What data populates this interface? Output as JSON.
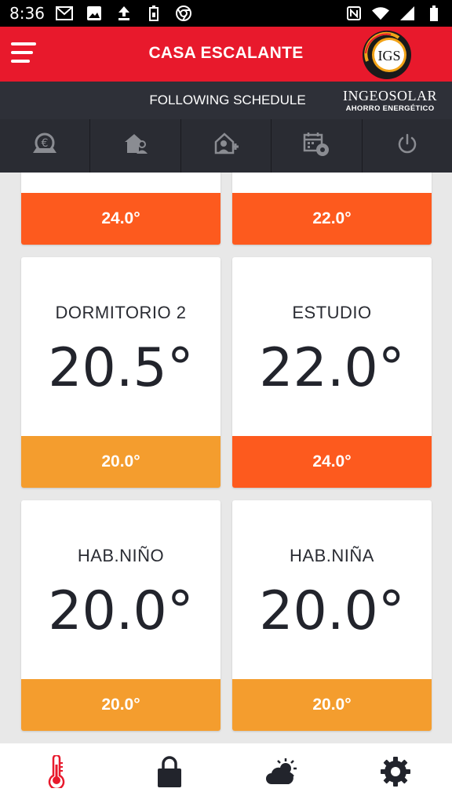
{
  "status_bar": {
    "time": "8:36",
    "left_icons": [
      "gmail-icon",
      "image-icon",
      "upload-icon",
      "battery-saver-icon",
      "chrome-icon"
    ],
    "right_icons": [
      "nfc-icon",
      "wifi-icon",
      "signal-icon",
      "battery-icon"
    ]
  },
  "app_bar": {
    "title": "CASA ESCALANTE",
    "menu_icon": "hamburger-menu-icon",
    "logo_text": "IGS"
  },
  "schedule_bar": {
    "status": "FOLLOWING SCHEDULE",
    "brand_name": "INGEOSOLAR",
    "brand_tagline": "AHORRO ENERGÉTICO"
  },
  "toolbar": {
    "items": [
      "euro-savings-icon",
      "home-user-icon",
      "home-user-add-icon",
      "schedule-settings-icon",
      "power-icon"
    ]
  },
  "zones": [
    {
      "name": "",
      "current": "",
      "setpoint": "24.0°",
      "mode": "hot"
    },
    {
      "name": "",
      "current": "",
      "setpoint": "22.0°",
      "mode": "hot"
    },
    {
      "name": "DORMITORIO 2",
      "current": "20.5°",
      "setpoint": "20.0°",
      "mode": "warm"
    },
    {
      "name": "ESTUDIO",
      "current": "22.0°",
      "setpoint": "24.0°",
      "mode": "hot"
    },
    {
      "name": "HAB.NIÑO",
      "current": "20.0°",
      "setpoint": "20.0°",
      "mode": "warm"
    },
    {
      "name": "HAB.NIÑA",
      "current": "20.0°",
      "setpoint": "20.0°",
      "mode": "warm"
    }
  ],
  "bottom_nav": {
    "items": [
      "thermometer-icon",
      "lock-icon",
      "weather-icon",
      "settings-gear-icon"
    ],
    "active": "thermometer-icon"
  },
  "colors": {
    "app_bar_red": "#e8192c",
    "dark_bar": "#2e3038",
    "setpoint_hot": "#fd5a1e",
    "setpoint_warm": "#f49d2e",
    "active_nav": "#e8192c"
  }
}
